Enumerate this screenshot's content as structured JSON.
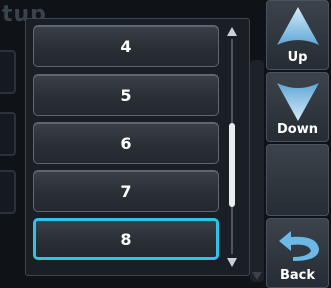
{
  "background": {
    "title_fragment": "tup"
  },
  "dropdown": {
    "options": [
      "4",
      "5",
      "6",
      "7",
      "8"
    ],
    "selected_option": "8"
  },
  "buttons": {
    "up_label": "Up",
    "down_label": "Down",
    "back_label": "Back"
  },
  "colors": {
    "selection": "#2ec4ea",
    "arrow_blue": "#8fc7ea"
  },
  "icons": {
    "up": "arrow-up-icon",
    "down": "arrow-down-icon",
    "back": "back-arrow-icon"
  }
}
